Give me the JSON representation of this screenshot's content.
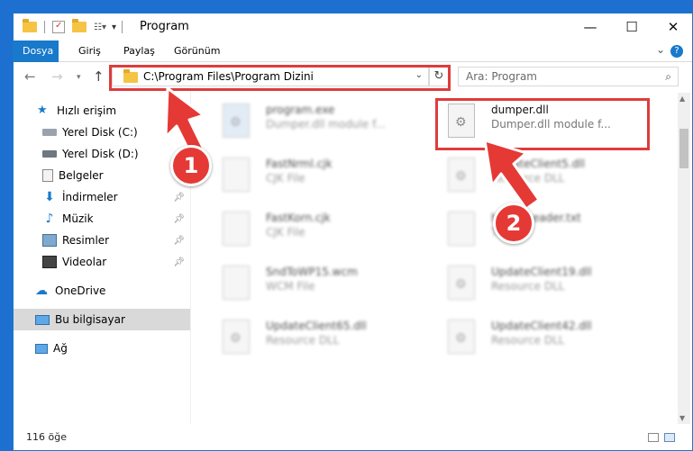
{
  "window": {
    "title": "Program",
    "minimize": "—",
    "maximize": "☐",
    "close": "✕"
  },
  "ribbon": {
    "tabs": [
      "Dosya",
      "Giriş",
      "Paylaş",
      "Görünüm"
    ],
    "help": "?"
  },
  "address": {
    "path": "C:\\Program Files\\Program Dizini"
  },
  "search": {
    "placeholder": "Ara: Program"
  },
  "sidebar": {
    "items": [
      {
        "label": "Hızlı erişim"
      },
      {
        "label": "Yerel Disk (C:)"
      },
      {
        "label": "Yerel Disk (D:)"
      },
      {
        "label": "Belgeler"
      },
      {
        "label": "İndirmeler"
      },
      {
        "label": "Müzik"
      },
      {
        "label": "Resimler"
      },
      {
        "label": "Videolar"
      },
      {
        "label": "OneDrive"
      },
      {
        "label": "Bu bilgisayar"
      },
      {
        "label": "Ağ"
      }
    ]
  },
  "files": [
    {
      "name": "program.exe",
      "desc": "Dumper.dll module f..."
    },
    {
      "name": "dumper.dll",
      "desc": "Dumper.dll module f..."
    },
    {
      "name": "FastNrml.cjk",
      "desc": "CJK File"
    },
    {
      "name": "UpdateClient5.dll",
      "desc": "Resource DLL"
    },
    {
      "name": "FastKorn.cjk",
      "desc": "CJK File"
    },
    {
      "name": "helpUIheader.txt",
      "desc": "TXT"
    },
    {
      "name": "SndToWP15.wcm",
      "desc": "WCM File"
    },
    {
      "name": "UpdateClient19.dll",
      "desc": "Resource DLL"
    },
    {
      "name": "UpdateClient65.dll",
      "desc": "Resource DLL"
    },
    {
      "name": "UpdateClient42.dll",
      "desc": "Resource DLL"
    }
  ],
  "status": {
    "count": "116 öğe"
  },
  "annotations": {
    "step1": "1",
    "step2": "2"
  },
  "colors": {
    "accent": "#1979ca",
    "highlight": "#de3c3c",
    "desktop": "#1d6fd0"
  }
}
